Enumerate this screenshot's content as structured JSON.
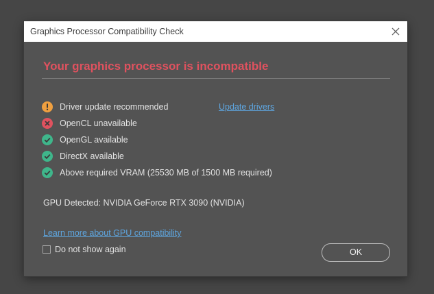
{
  "dialog": {
    "title": "Graphics Processor Compatibility Check",
    "heading": "Your graphics processor is incompatible",
    "heading_color": "#e0525f",
    "checks": [
      {
        "label": "Driver update recommended",
        "status": "warning",
        "icon": "warning-icon",
        "color": "#f0a040",
        "action_link": "Update drivers"
      },
      {
        "label": "OpenCL unavailable",
        "status": "error",
        "icon": "error-icon",
        "color": "#e0525f"
      },
      {
        "label": "OpenGL available",
        "status": "ok",
        "icon": "check-icon",
        "color": "#3fb68b"
      },
      {
        "label": "DirectX available",
        "status": "ok",
        "icon": "check-icon",
        "color": "#3fb68b"
      },
      {
        "label": "Above required VRAM (25530 MB of 1500 MB required)",
        "status": "ok",
        "icon": "check-icon",
        "color": "#3fb68b"
      }
    ],
    "gpu_detected": "GPU Detected: NVIDIA GeForce RTX 3090 (NVIDIA)",
    "learn_more_link": "Learn more about GPU compatibility",
    "do_not_show_label": "Do not show again",
    "do_not_show_checked": false,
    "ok_label": "OK",
    "link_color": "#5ea6e0"
  }
}
